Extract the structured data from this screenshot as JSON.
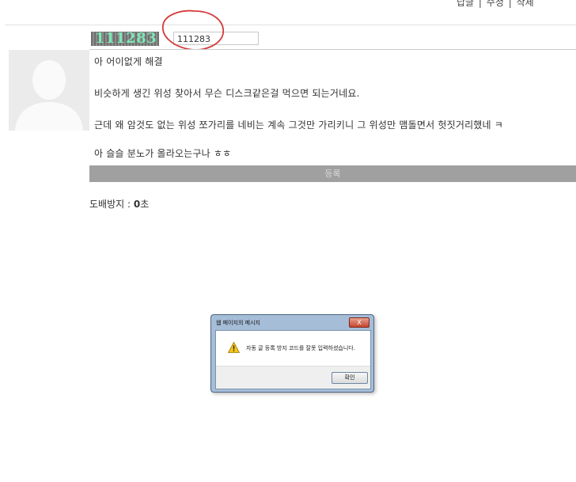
{
  "top_nav": {
    "items": [
      "답글",
      "수정",
      "삭제"
    ],
    "separator": "|"
  },
  "captcha": {
    "code": "111283",
    "input_value": "111283"
  },
  "comment": {
    "lines": [
      "아 어이없게 해결",
      "비슷하게 생긴 위성 찾아서 무슨 디스크같은걸 먹으면 되는거네요.",
      "근데 왜 암것도 없는 위성 쪼가리를 네비는 계속 그것만 가리키니 그 위성만 맴돌면서 헛짓거리했네 ㅋ",
      "아 슬슬 분노가 올라오는구나 ㅎㅎ"
    ],
    "submit_label": "등록"
  },
  "spam_guard": {
    "label": "도배방지 : ",
    "value": "0",
    "unit": "초"
  },
  "dialog": {
    "title": "웹 페이지의 메시지",
    "message": "자동 글 등록 방지 코드를 잘못 입력하셨습니다.",
    "ok_label": "확인",
    "close_glyph": "X"
  },
  "colors": {
    "captcha_text": "#7ee7b6",
    "annotation_circle": "#d63a3a",
    "submit_bar": "#a0a0a0"
  }
}
